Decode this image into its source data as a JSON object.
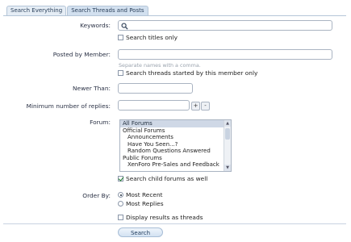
{
  "tabs": [
    "Search Everything",
    "Search Threads and Posts"
  ],
  "form": {
    "keywords_label": "Keywords:",
    "keywords_value": "",
    "search_titles_label": "Search titles only",
    "posted_by_label": "Posted by Member:",
    "posted_by_value": "",
    "posted_by_hint": "Separate names with a comma.",
    "started_by_label": "Search threads started by this member only",
    "newer_than_label": "Newer Than:",
    "newer_than_value": "",
    "min_replies_label": "Minimum number of replies:",
    "min_replies_value": "",
    "plus": "+",
    "minus": "-",
    "forum_label": "Forum:",
    "forum_options": [
      "All Forums",
      "Official Forums",
      "Announcements",
      "Have You Seen...?",
      "Random Questions Answered",
      "Public Forums",
      "XenForo Pre-Sales and Feedback"
    ],
    "search_child_label": "Search child forums as well",
    "order_by_label": "Order By:",
    "order_most_recent": "Most Recent",
    "order_most_replies": "Most Replies",
    "display_threads_label": "Display results as threads",
    "search_button": "Search"
  }
}
